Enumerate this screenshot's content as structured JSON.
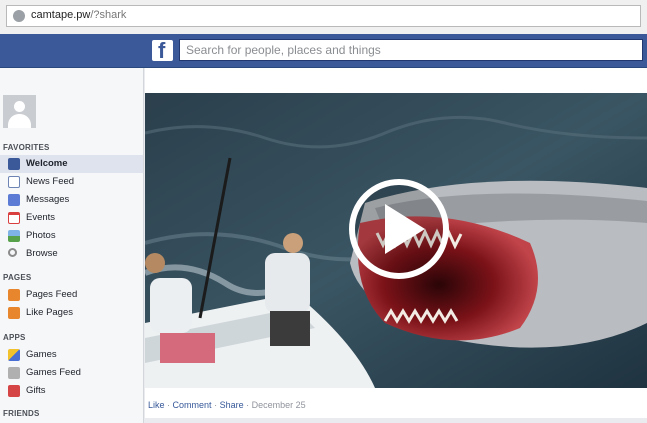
{
  "browser": {
    "url_host": "camtape.pw",
    "url_path": "/?shark"
  },
  "header": {
    "logo": "f",
    "search_placeholder": "Search for people, places and things"
  },
  "sidebar": {
    "favorites_heading": "FAVORITES",
    "favorites": [
      {
        "label": "Welcome",
        "icon": "facebook-icon",
        "color": "#3b5998"
      },
      {
        "label": "News Feed",
        "icon": "news-feed-icon",
        "color": "#6d84b4"
      },
      {
        "label": "Messages",
        "icon": "messages-icon",
        "color": "#5b7bd5"
      },
      {
        "label": "Events",
        "icon": "calendar-icon",
        "color": "#d93f3f"
      },
      {
        "label": "Photos",
        "icon": "photos-icon",
        "color": "#56a14a"
      },
      {
        "label": "Browse",
        "icon": "search-icon",
        "color": "#8b8b8b"
      }
    ],
    "pages_heading": "PAGES",
    "pages": [
      {
        "label": "Pages Feed",
        "icon": "flag-icon",
        "color": "#e8862d"
      },
      {
        "label": "Like Pages",
        "icon": "flag-icon",
        "color": "#e8862d"
      }
    ],
    "apps_heading": "APPS",
    "apps": [
      {
        "label": "Games",
        "icon": "games-icon",
        "color": "#f2c12e"
      },
      {
        "label": "Games Feed",
        "icon": "games-feed-icon",
        "color": "#b0b0b0"
      },
      {
        "label": "Gifts",
        "icon": "gift-icon",
        "color": "#d64545"
      }
    ],
    "friends_heading": "FRIENDS"
  },
  "post": {
    "like": "Like",
    "comment": "Comment",
    "share": "Share",
    "separator": "·",
    "date": "December 25",
    "play_icon": "play-icon"
  }
}
